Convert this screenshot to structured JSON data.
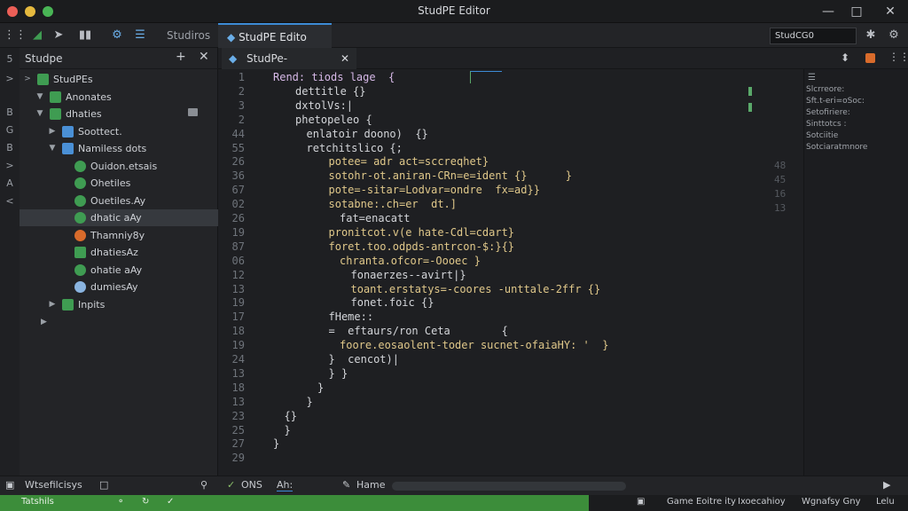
{
  "window": {
    "title": "StudPE Editor"
  },
  "colors": {
    "accent": "#3d8bd6",
    "status_green": "#3c8d3a",
    "folder_green": "#3f9c52"
  },
  "toolbar": {
    "icons": [
      "grid-icon",
      "folder-icon",
      "arrow-right-icon",
      "panel-icon",
      "puzzle-icon",
      "debug-icon"
    ],
    "tabs": [
      {
        "label": "Studiros"
      },
      {
        "label": "StudPE Edito"
      }
    ],
    "search_value": "StudCG0"
  },
  "left_gutter": [
    "5",
    ">",
    "B",
    "G",
    "B",
    ">",
    "A",
    "<"
  ],
  "sidebar": {
    "title": "Studpe",
    "items": [
      {
        "label": "StudPEs",
        "indent": 0,
        "twisty": ">",
        "icon": "folder-icon",
        "selected": false
      },
      {
        "label": "Anonates",
        "indent": 1,
        "twisty": "▼",
        "icon": "folder-icon",
        "selected": false
      },
      {
        "label": "dhaties",
        "indent": 1,
        "twisty": "▼",
        "icon": "folder-icon",
        "selected": false
      },
      {
        "label": "Soottect.",
        "indent": 2,
        "twisty": "▶",
        "icon": "file-icon",
        "selected": false
      },
      {
        "label": "Namiless dots",
        "indent": 2,
        "twisty": "▼",
        "icon": "file-icon",
        "selected": false
      },
      {
        "label": "Ouidon.etsais",
        "indent": 3,
        "twisty": "",
        "icon": "node-icon",
        "selected": false
      },
      {
        "label": "Ohetiles",
        "indent": 3,
        "twisty": "",
        "icon": "node-icon",
        "selected": false
      },
      {
        "label": "Ouetiles.Ay",
        "indent": 3,
        "twisty": "",
        "icon": "node-icon",
        "selected": false
      },
      {
        "label": "dhatic aAy",
        "indent": 3,
        "twisty": "",
        "icon": "node-icon",
        "selected": true
      },
      {
        "label": "Thamniy8y",
        "indent": 3,
        "twisty": "",
        "icon": "alert-icon",
        "selected": false
      },
      {
        "label": "dhatiesAz",
        "indent": 3,
        "twisty": "",
        "icon": "play-icon",
        "selected": false
      },
      {
        "label": "ohatie aAy",
        "indent": 3,
        "twisty": "",
        "icon": "node-icon",
        "selected": false
      },
      {
        "label": "dumiesAy",
        "indent": 3,
        "twisty": "",
        "icon": "db-icon",
        "selected": false
      },
      {
        "label": "Inpits",
        "indent": 2,
        "twisty": "▶",
        "icon": "play-icon",
        "selected": false
      }
    ]
  },
  "editor": {
    "tab_label": "StudPe-",
    "lines": [
      {
        "num": "1",
        "indent": 0,
        "text": "Rend: tiods lage  {"
      },
      {
        "num": "2",
        "indent": 2,
        "text": "dettitle {}"
      },
      {
        "num": "3",
        "indent": 2,
        "text": "dxtolVs:|"
      },
      {
        "num": "2",
        "indent": 2,
        "text": "phetopeleo {"
      },
      {
        "num": "44",
        "indent": 3,
        "text": "enlatoir doono)  {}"
      },
      {
        "num": "55",
        "indent": 3,
        "text": "retchitslico {;"
      },
      {
        "num": "26",
        "indent": 5,
        "text": "potee= adr act=sccreqhet}"
      },
      {
        "num": "36",
        "indent": 5,
        "text": "sotohr-ot.aniran-CRn=e=ident {}      }"
      },
      {
        "num": "67",
        "indent": 5,
        "text": "pote=-sitar=Lodvar=ondre  fx=ad}}"
      },
      {
        "num": "02",
        "indent": 5,
        "text": "sotabne:.ch=er  dt.]"
      },
      {
        "num": "26",
        "indent": 6,
        "text": "fat=enacatt"
      },
      {
        "num": "19",
        "indent": 5,
        "text": "pronitcot.v(e hate-Cdl=cdart}"
      },
      {
        "num": "87",
        "indent": 5,
        "text": "foret.too.odpds-antrcon-$:}{}"
      },
      {
        "num": "06",
        "indent": 6,
        "text": "chranta.ofcor=-Oooec }"
      },
      {
        "num": "12",
        "indent": 7,
        "text": "fonaerzes--avirt|}"
      },
      {
        "num": "13",
        "indent": 7,
        "text": "toant.erstatys=-coores -unttale-2ffr {}"
      },
      {
        "num": "19",
        "indent": 7,
        "text": "fonet.foic {}"
      },
      {
        "num": "17",
        "indent": 5,
        "text": "fHeme::"
      },
      {
        "num": "18",
        "indent": 5,
        "text": "=  eftaurs/ron Ceta        {"
      },
      {
        "num": "19",
        "indent": 6,
        "text": "foore.eosaolent-toder sucnet-ofaiaHY: '  }"
      },
      {
        "num": "24",
        "indent": 5,
        "text": "}  cencot)|"
      },
      {
        "num": "13",
        "indent": 5,
        "text": "} }"
      },
      {
        "num": "18",
        "indent": 4,
        "text": "}"
      },
      {
        "num": "13",
        "indent": 3,
        "text": "}"
      },
      {
        "num": "23",
        "indent": 1,
        "text": "{}"
      },
      {
        "num": "25",
        "indent": 1,
        "text": "}"
      },
      {
        "num": "27",
        "indent": 0,
        "text": "}"
      },
      {
        "num": "29",
        "indent": 0,
        "text": ""
      }
    ]
  },
  "right_panel": {
    "lines": [
      "Slcrreore:",
      "Sft.t-eri=oSoc:",
      "Setofiriere:",
      "Sinttotcs :",
      "Sotciitie",
      "Sotciaratmnore"
    ],
    "nums": [
      "48",
      "45",
      "16",
      "13"
    ]
  },
  "bottom_bar": {
    "left_label": "Wtsefilcisys",
    "tabs": [
      "ONS",
      "Ah:",
      "Hame"
    ]
  },
  "status_bar": {
    "left_text": "Tatshils",
    "icons": [
      "branch-icon",
      "sync-icon",
      "check-icon"
    ],
    "right": [
      "Game Eoitre ity",
      "Ixoecahioy",
      "Wgnafsy Gny",
      "Lelu"
    ]
  }
}
